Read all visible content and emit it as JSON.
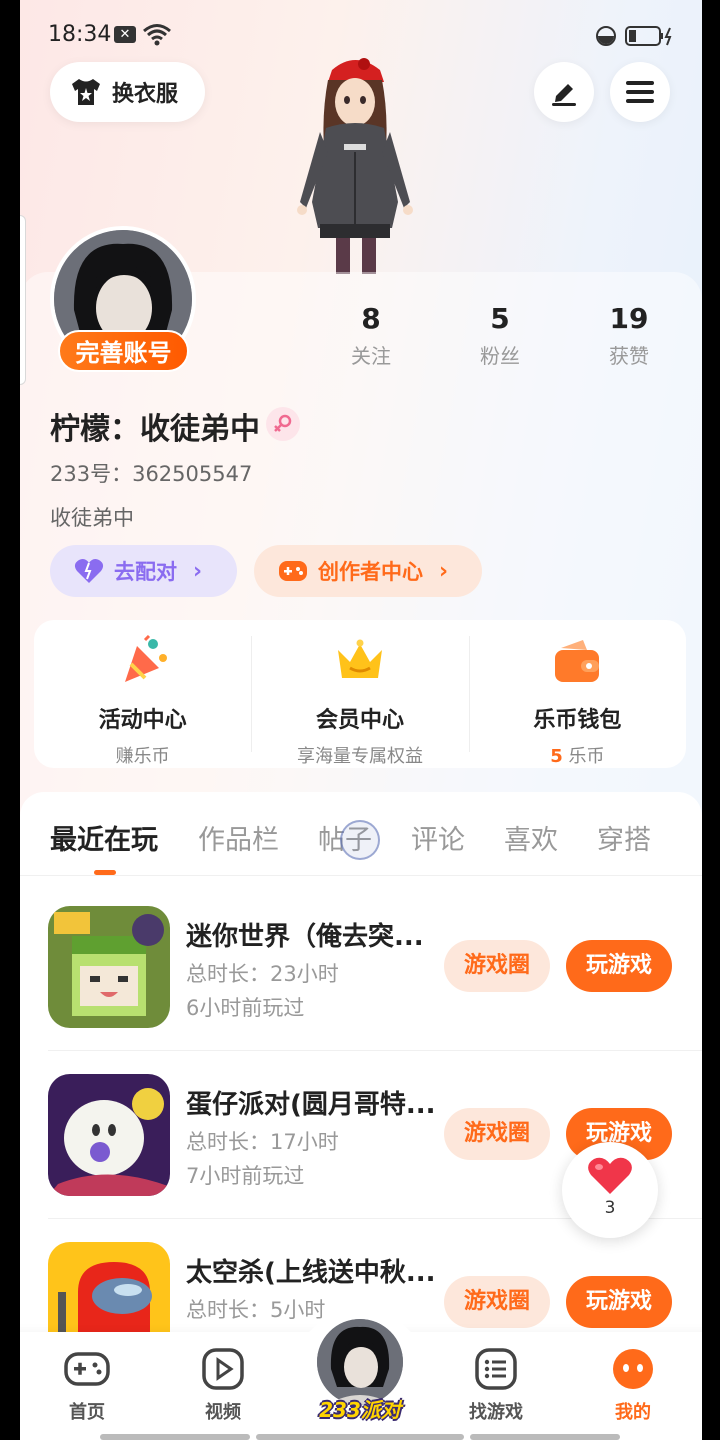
{
  "status": {
    "time": "18:34",
    "notification_badge": "✕"
  },
  "header": {
    "outfit_label": "换衣服"
  },
  "profile": {
    "badge": "完善账号",
    "stats": [
      {
        "value": "8",
        "label": "关注"
      },
      {
        "value": "5",
        "label": "粉丝"
      },
      {
        "value": "19",
        "label": "获赞"
      }
    ],
    "username": "柠檬：收徒弟中",
    "uid": "233号：362505547",
    "bio": "收徒弟中",
    "match_label": "去配对",
    "creator_label": "创作者中心"
  },
  "features": [
    {
      "title": "活动中心",
      "sub": "赚乐币"
    },
    {
      "title": "会员中心",
      "sub": "享海量专属权益"
    },
    {
      "title": "乐币钱包",
      "sub_num": "5",
      "sub": "乐币"
    }
  ],
  "tabs": [
    "最近在玩",
    "作品栏",
    "帖子",
    "评论",
    "喜欢",
    "穿搭"
  ],
  "games": [
    {
      "title": "迷你世界（俺去突...",
      "duration": "总时长：23小时",
      "last": "6小时前玩过",
      "circle_label": "游戏圈",
      "play_label": "玩游戏"
    },
    {
      "title": "蛋仔派对(圆月哥特...",
      "duration": "总时长：17小时",
      "last": "7小时前玩过",
      "circle_label": "游戏圈",
      "play_label": "玩游戏"
    },
    {
      "title": "太空杀(上线送中秋...",
      "duration": "总时长：5小时",
      "last": "",
      "circle_label": "游戏圈",
      "play_label": "玩游戏"
    }
  ],
  "like_fab": {
    "count": "3"
  },
  "nav": {
    "home": "首页",
    "video": "视频",
    "center": "233派对",
    "find": "找游戏",
    "mine": "我的"
  },
  "colors": {
    "accent": "#ff6a1a",
    "match": "#8a6cf0"
  }
}
